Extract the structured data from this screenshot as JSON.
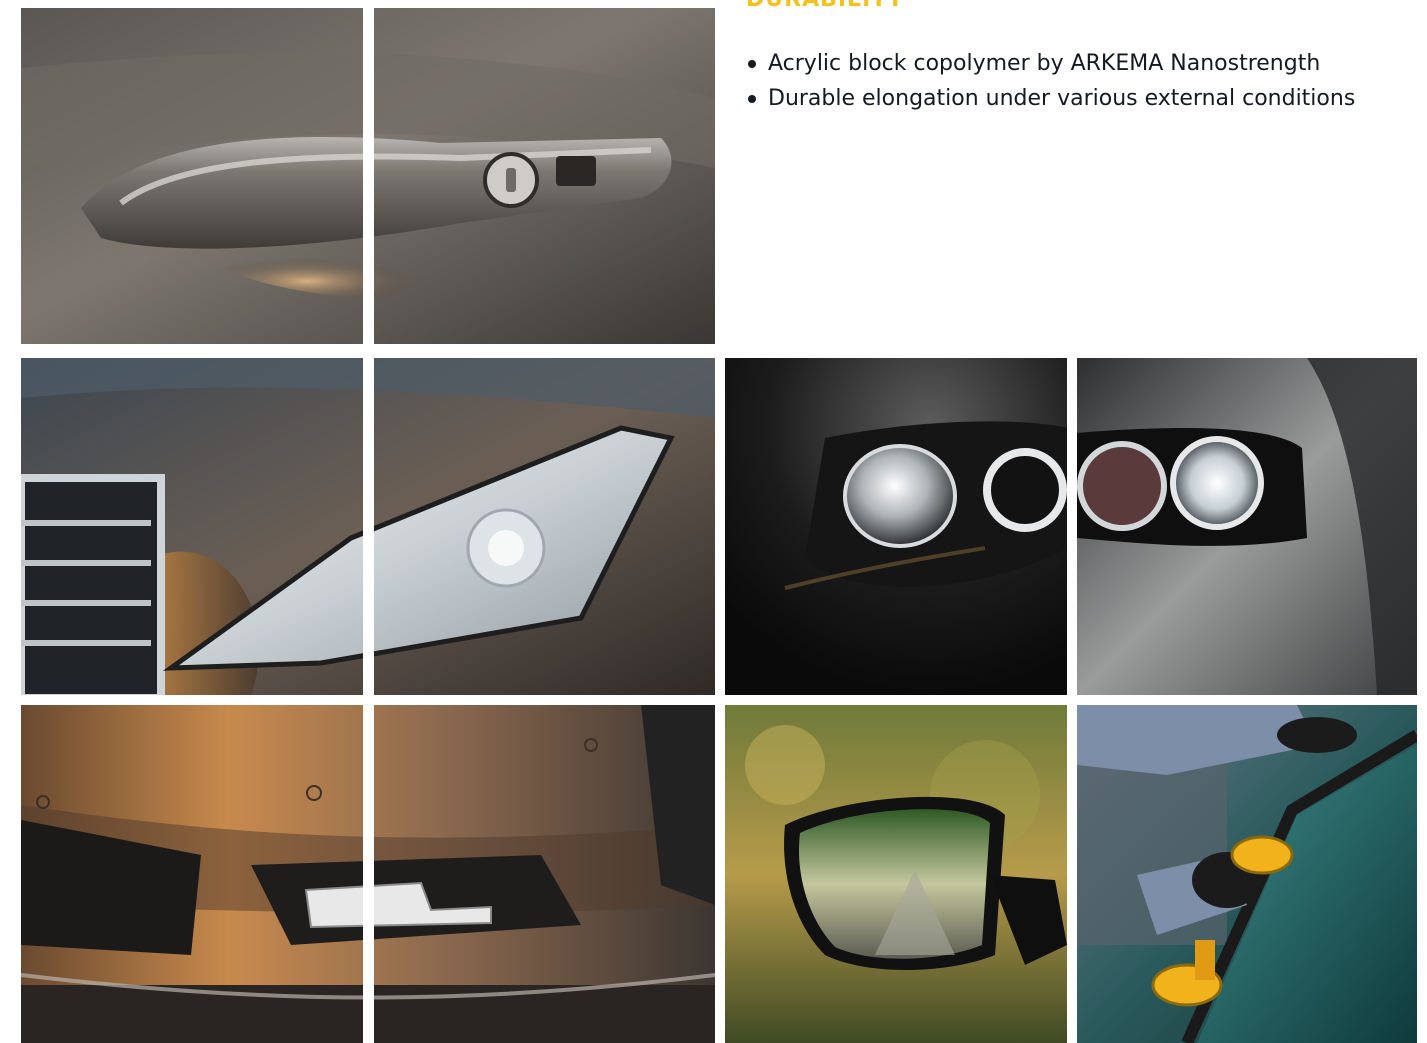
{
  "section": {
    "heading": "DURABILITY",
    "bullets": [
      {
        "text": "Acrylic block copolymer by ARKEMA Nanostrength"
      },
      {
        "text": "Durable elongation under various external conditions"
      }
    ]
  },
  "gallery": [
    {
      "name": "door-handle-photo",
      "subject": "Car door handle with lock"
    },
    {
      "name": "headlight-sedan-photo",
      "subject": "Sedan headlight and chrome grille"
    },
    {
      "name": "headlight-dark-photo",
      "subject": "Projector headlight on dark car"
    },
    {
      "name": "headlight-silver-photo",
      "subject": "Headlight on silver car"
    },
    {
      "name": "front-bumper-photo",
      "subject": "Front bumper with LED daytime lights"
    },
    {
      "name": "side-mirror-photo",
      "subject": "Side mirror reflecting tree-lined road"
    },
    {
      "name": "windshield-install-photo",
      "subject": "Windshield installation with suction cups"
    }
  ],
  "colors": {
    "accent": "#f4c21f",
    "text": "#141a22",
    "background": "#ffffff"
  }
}
